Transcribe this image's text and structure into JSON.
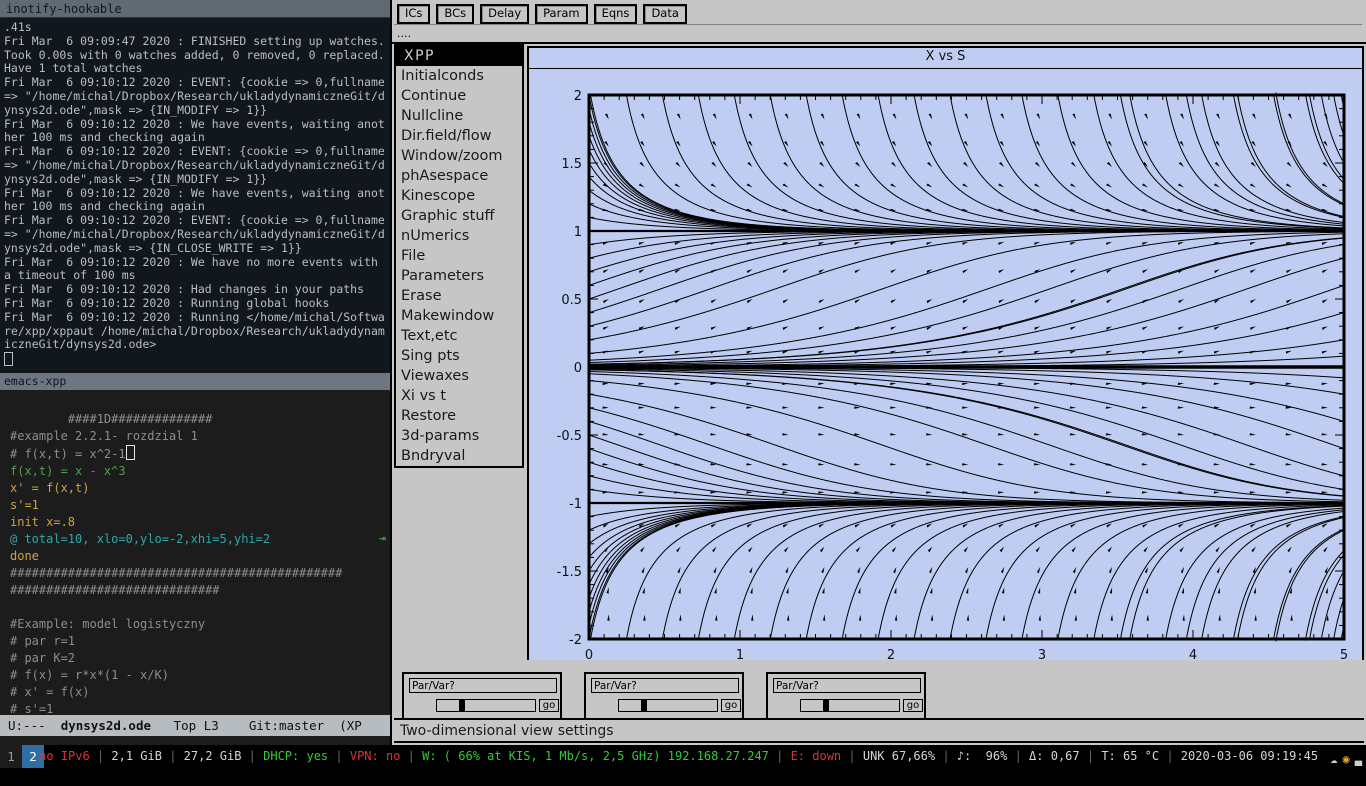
{
  "terminal": {
    "title": "inotify-hookable",
    "lines": [
      ".41s",
      "Fri Mar  6 09:09:47 2020 : FINISHED setting up watches. Took 0.00s with 0 watches added, 0 removed, 0 replaced. Have 1 total watches",
      "Fri Mar  6 09:10:12 2020 : EVENT: {cookie => 0,fullname => \"/home/michal/Dropbox/Research/ukladydynamiczneGit/dynsys2d.ode\",mask => {IN_MODIFY => 1}}",
      "Fri Mar  6 09:10:12 2020 : We have events, waiting another 100 ms and checking again",
      "Fri Mar  6 09:10:12 2020 : EVENT: {cookie => 0,fullname => \"/home/michal/Dropbox/Research/ukladydynamiczneGit/dynsys2d.ode\",mask => {IN_MODIFY => 1}}",
      "Fri Mar  6 09:10:12 2020 : We have events, waiting another 100 ms and checking again",
      "Fri Mar  6 09:10:12 2020 : EVENT: {cookie => 0,fullname => \"/home/michal/Dropbox/Research/ukladydynamiczneGit/dynsys2d.ode\",mask => {IN_CLOSE_WRITE => 1}}",
      "Fri Mar  6 09:10:12 2020 : We have no more events with a timeout of 100 ms",
      "Fri Mar  6 09:10:12 2020 : Had changes in your paths",
      "Fri Mar  6 09:10:12 2020 : Running global hooks",
      "Fri Mar  6 09:10:12 2020 : Running </home/michal/Software/xpp/xppaut /home/michal/Dropbox/Research/ukladydynamiczneGit/dynsys2d.ode>"
    ]
  },
  "emacs": {
    "title": "emacs-xpp",
    "code_lines": [
      "####1D##############",
      "#example 2.2.1- rozdzial 1",
      "# f(x,t) = x^2-1",
      "f(x,t) = x - x^3",
      "x' = f(x,t)",
      "s'=1",
      "init x=.8",
      "@ total=10, xlo=0,ylo=-2,xhi=5,yhi=2",
      "done",
      "##############################################",
      "#############################",
      "",
      "#Example: model logistyczny",
      "# par r=1",
      "# par K=2",
      "# f(x) = r*x*(1 - x/K)",
      "# x' = f(x)",
      "# s'=1"
    ],
    "modeline": {
      "state": "U:---",
      "filename": "dynsys2d.ode",
      "position": "Top L3",
      "vc": "Git:master",
      "mode": "(XP"
    }
  },
  "xpp": {
    "toolbar_buttons": [
      "ICs",
      "BCs",
      "Delay",
      "Param",
      "Eqns",
      "Data"
    ],
    "message_line": "....",
    "menu_title": "XPP",
    "menu_items": [
      "Initialconds",
      "Continue",
      "Nullcline",
      "Dir.field/flow",
      "Window/zoom",
      "phAsespace",
      "Kinescope",
      "Graphic stuff",
      "nUmerics",
      "File",
      "Parameters",
      "Erase",
      "Makewindow",
      "Text,etc",
      "Sing pts",
      "Viewaxes",
      "Xi vs t",
      "Restore",
      "3d-params",
      "Bndryval"
    ],
    "sliders": [
      {
        "label": "Par/Var?",
        "go": "go"
      },
      {
        "label": "Par/Var?",
        "go": "go"
      },
      {
        "label": "Par/Var?",
        "go": "go"
      }
    ],
    "status_text": "Two-dimensional view settings"
  },
  "chart_data": {
    "type": "line",
    "title": "X vs S",
    "xlabel": "",
    "ylabel": "",
    "xlim": [
      0,
      5
    ],
    "ylim": [
      -2,
      2
    ],
    "xticks": [
      0,
      1,
      2,
      3,
      4,
      5
    ],
    "yticks": [
      -2,
      -1.5,
      -1,
      -0.5,
      0,
      0.5,
      1,
      1.5,
      2
    ],
    "xtick_labels": [
      "0",
      "1",
      "2",
      "3",
      "4",
      "5"
    ],
    "ytick_labels": [
      "-2",
      "-1.5",
      "-1",
      "-0.5",
      "0",
      "0.5",
      "1",
      "1.5",
      "2"
    ],
    "grid": false,
    "legend": false,
    "bgcolor": "#bfcdf2",
    "linecolor": "#000000",
    "description": "Direction field / flow of x' = x - x^3, s' = 1 : trajectories converge to the stable fixed points x = 1 and x = -1 and diverge away from the unstable fixed point x = 0.",
    "equilibria": [
      {
        "y": 1,
        "stability": "stable"
      },
      {
        "y": 0,
        "stability": "unstable"
      },
      {
        "y": -1,
        "stability": "stable"
      }
    ],
    "initial_values": [
      -2,
      -1.9,
      -1.8,
      -1.7,
      -1.6,
      -1.5,
      -1.4,
      -1.3,
      -1.2,
      -1.1,
      -1,
      -0.9,
      -0.8,
      -0.7,
      -0.6,
      -0.5,
      -0.4,
      -0.3,
      -0.2,
      -0.1,
      -0.05,
      -0.02,
      0,
      0.02,
      0.05,
      0.1,
      0.2,
      0.3,
      0.4,
      0.5,
      0.6,
      0.7,
      0.8,
      0.9,
      1,
      1.1,
      1.2,
      1.3,
      1.4,
      1.5,
      1.6,
      1.7,
      1.8,
      1.9,
      2
    ],
    "arrow_columns": 21
  },
  "statusbar": {
    "workspaces": [
      "1",
      "2"
    ],
    "active_workspace": "2",
    "items": [
      {
        "text": "no IPv6",
        "color": "#dd3333"
      },
      {
        "text": "2,1 GiB",
        "color": "#d6d6d6"
      },
      {
        "text": "27,2 GiB",
        "color": "#d6d6d6"
      },
      {
        "text": "DHCP: yes",
        "color": "#33cc33"
      },
      {
        "text": "VPN: no",
        "color": "#dd3333"
      },
      {
        "text": "W: ( 66% at KIS, 1 Mb/s, 2,5 GHz) 192.168.27.247",
        "color": "#33cc33"
      },
      {
        "text": "E: down",
        "color": "#dd3333"
      },
      {
        "text": "UNK 67,66%",
        "color": "#d6d6d6"
      },
      {
        "text": "♪:  96%",
        "color": "#d6d6d6"
      },
      {
        "text": "Δ: 0,67",
        "color": "#d6d6d6"
      },
      {
        "text": "T: 65 °C",
        "color": "#d6d6d6"
      },
      {
        "text": "2020-03-06 09:19:45",
        "color": "#d6d6d6"
      }
    ],
    "tray_icons": [
      "owncloud-icon",
      "chrome-icon",
      "signal-icon"
    ]
  }
}
